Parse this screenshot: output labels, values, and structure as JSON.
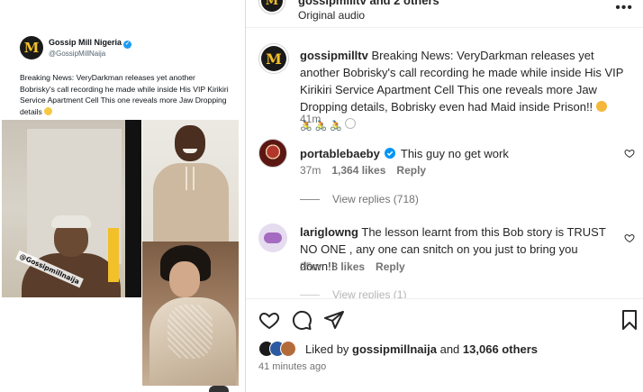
{
  "tweet": {
    "avatar_letter": "M",
    "name": "Gossip Mill Nigeria",
    "handle": "@GossipMillNaija",
    "text": "VeryDarkman releases yet  another Bobrisky's call recording he made while inside His VIP Kirikiri Service Apartment Cell This one reveals more Jaw Dropping details",
    "text_lead": "Breaking News:",
    "watermark": "@Gossipmillnaija"
  },
  "header": {
    "username": "gossipmilltv and 2 others",
    "audio": "Original audio",
    "more_label": "•••"
  },
  "caption": {
    "username": "gossipmilltv",
    "text": "Breaking News: VeryDarkman releases yet another Bobrisky's call recording he made while inside His VIP Kirikiri Service Apartment Cell This one reveals more Jaw Dropping details, Bobrisky even had Maid inside Prison!!",
    "time": "41m"
  },
  "comments": [
    {
      "username": "portablebaeby",
      "verified": true,
      "text": "This guy no get work",
      "time": "37m",
      "likes": "1,364 likes",
      "reply": "Reply",
      "view_replies": "View replies (718)"
    },
    {
      "username": "lariglowng",
      "verified": false,
      "text": "The lesson learnt from this Bob story is TRUST NO ONE , any one can snitch on you just to bring you down!!",
      "time": "25m",
      "likes": "8 likes",
      "reply": "Reply",
      "view_replies": "View replies (1)"
    }
  ],
  "footer": {
    "liked_prefix": "Liked by",
    "liked_user": "gossipmillnaija",
    "liked_and": "and",
    "liked_count": "13,066 others",
    "time": "41 minutes ago"
  },
  "colors": {
    "brand_gold": "#f2c029",
    "verified_blue": "#0095f6",
    "muted_text": "#737373"
  }
}
